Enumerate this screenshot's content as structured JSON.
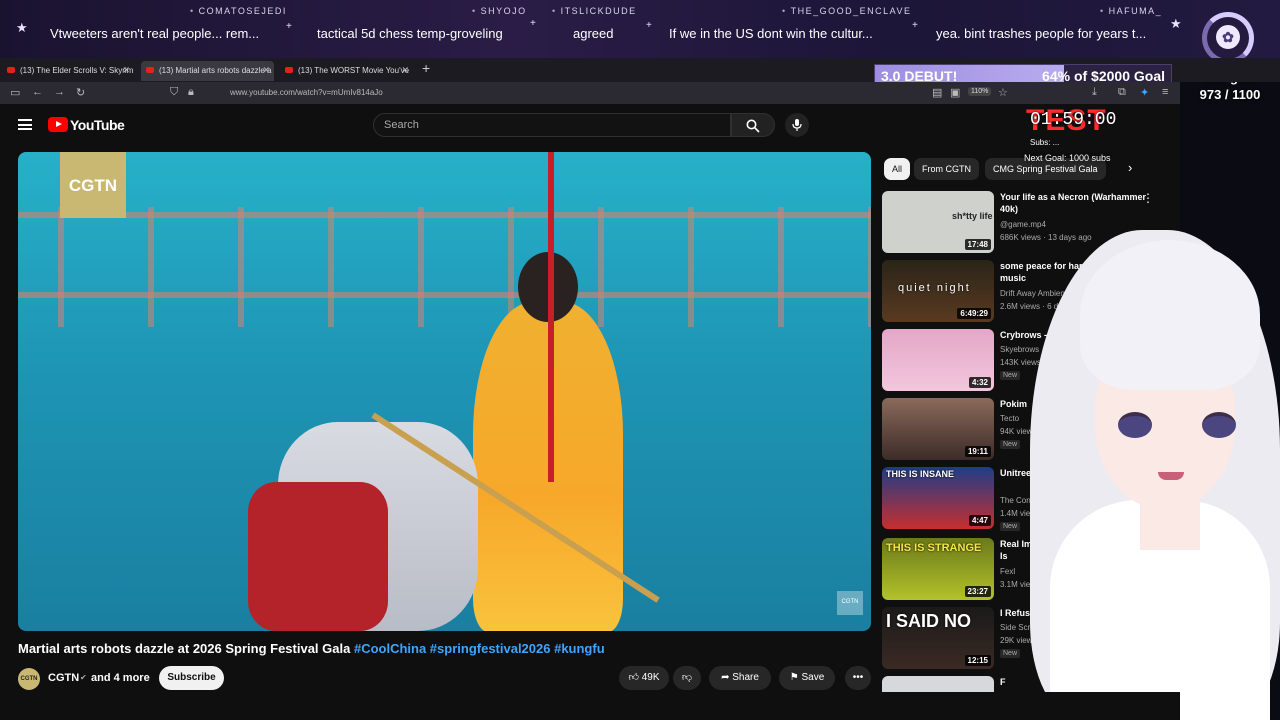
{
  "chat": [
    {
      "user": "",
      "text": "Vtweeters aren't real people... rem..."
    },
    {
      "user": "SHYOJO",
      "text": "tactical 5d chess temp-groveling"
    },
    {
      "user": "ITSLICKDUDE",
      "text": "agreed"
    },
    {
      "user": "THE_GOOD_ENCLAVE",
      "text": "If we in the US dont win the cultur..."
    },
    {
      "user": "HAFUMA_",
      "text": "yea. bint trashes people for years t..."
    }
  ],
  "chat_first_user": "COMATOSEJEDI",
  "sub_goal": {
    "label": "sub goal",
    "count": "973 / 1100"
  },
  "donation_goal": {
    "left": "3.0 DEBUT!",
    "right": "64% of $2000 Goal",
    "progress": 0.64
  },
  "tabs": [
    {
      "label": "(13) The Elder Scrolls V: Skyrim"
    },
    {
      "label": "(13) Martial arts robots dazzle a"
    },
    {
      "label": "(13) The WORST Movie You've"
    }
  ],
  "browser": {
    "url": "www.youtube.com/watch?v=mUmIv814aJo",
    "zoom": "110%"
  },
  "youtube": {
    "logo": "YouTube",
    "search_placeholder": "Search",
    "video_title": "Martial arts robots dazzle at 2026 Spring Festival Gala",
    "video_tags": "#CoolChina #springfestival2026 #kungfu",
    "channel": "CGTN",
    "channel_more": "and 4 more",
    "subscribe": "Subscribe",
    "likes": "49K",
    "share": "Share",
    "save": "Save",
    "video_logo": "CGTN",
    "watermark": "CGTN"
  },
  "chips": [
    "All",
    "From CGTN",
    "CMG Spring Festival Gala"
  ],
  "recommendations": [
    {
      "title": "Your life as a Necron (Warhammer 40k)",
      "channel": "@game.mp4",
      "meta": "686K views · 13 days ago",
      "duration": "17:48",
      "thumb_text": "sh*tty life",
      "badge": ""
    },
    {
      "title": "some peace for hard (minecraft music",
      "channel": "Drift Away Ambien",
      "meta": "2.6M views · 6 days",
      "duration": "6:49:29",
      "thumb_text": "quiet night",
      "badge": ""
    },
    {
      "title": "Crybrows -",
      "channel": "Skyebrows",
      "meta": "143K views",
      "duration": "4:32",
      "thumb_text": "",
      "badge": "New"
    },
    {
      "title": "Pokim",
      "channel": "Tecto",
      "meta": "94K views",
      "duration": "19:11",
      "thumb_text": "",
      "badge": "New"
    },
    {
      "title": "Unitree dem Chinese New",
      "channel": "The Construct Ro",
      "meta": "1.4M views · 3 days",
      "duration": "4:47",
      "thumb_text": "THIS IS INSANE",
      "badge": "New"
    },
    {
      "title": "Real Images Of Ve That Something Is",
      "channel": "Fexl",
      "meta": "3.1M views · 11",
      "duration": "23:27",
      "thumb_text": "THIS IS STRANGE",
      "badge": ""
    },
    {
      "title": "I Refused. N",
      "channel": "Side Scrollers",
      "meta": "29K views",
      "duration": "12:15",
      "thumb_text": "I SAID NO",
      "badge": "New"
    },
    {
      "title": "F",
      "channel": "",
      "meta": "",
      "duration": "",
      "thumb_text": "",
      "badge": ""
    }
  ],
  "overlay": {
    "test": "TEST",
    "timer": "01:59:00",
    "subs": "Subs: ...",
    "next_goal": "Next Goal: 1000 subs"
  },
  "colors": {
    "accent": "#3ea6ff",
    "brand": "#ff0000",
    "goal": "#b8acef"
  }
}
